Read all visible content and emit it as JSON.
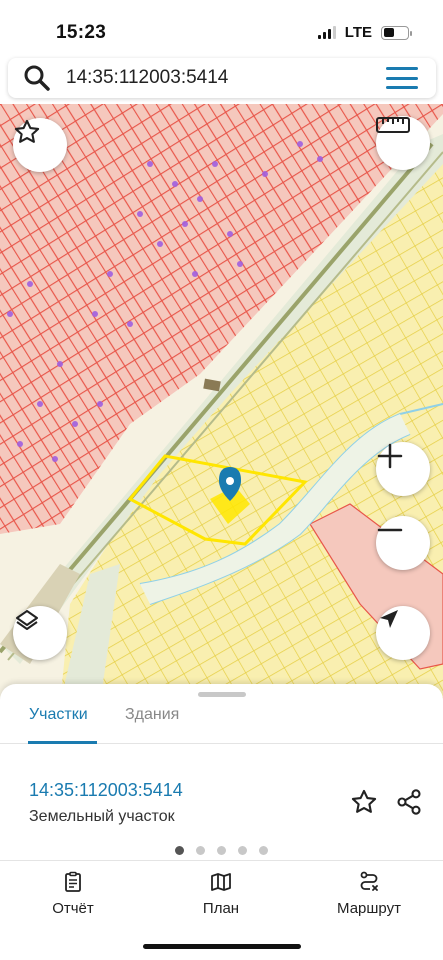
{
  "status_bar": {
    "time": "15:23",
    "network": "LTE",
    "signal_bars": 3,
    "battery_level": 0.45
  },
  "search": {
    "query": "14:35:112003:5414",
    "icon": "search-icon",
    "menu_icon": "hamburger-menu-icon"
  },
  "map": {
    "buttons": {
      "favorite": "star-icon",
      "ruler": "ruler-icon",
      "zoom_in": "plus-icon",
      "zoom_out": "minus-icon",
      "layers": "layers-icon",
      "locate": "navigation-arrow-icon"
    },
    "colors": {
      "built_zone": "#f5c8bd",
      "built_zone_lines": "#e8564a",
      "dacha_zone": "#f9efb0",
      "dacha_zone_lines": "#e6cf46",
      "selected_parcel": "#ffe600",
      "river": "#8fd0e8",
      "road": "#e4ead8",
      "building_markers": "#a05fe0",
      "marker": "#1a7bb0"
    }
  },
  "sheet": {
    "tabs": [
      {
        "label": "Участки",
        "active": true
      },
      {
        "label": "Здания",
        "active": false
      }
    ],
    "parcel": {
      "number": "14:35:112003:5414",
      "type": "Земельный участок"
    },
    "pager": {
      "pages": 5,
      "current": 1
    }
  },
  "bottom_nav": [
    {
      "label": "Отчёт",
      "icon": "report-icon"
    },
    {
      "label": "План",
      "icon": "map-plan-icon"
    },
    {
      "label": "Маршрут",
      "icon": "route-icon"
    }
  ],
  "accent_color": "#1a7bb0"
}
